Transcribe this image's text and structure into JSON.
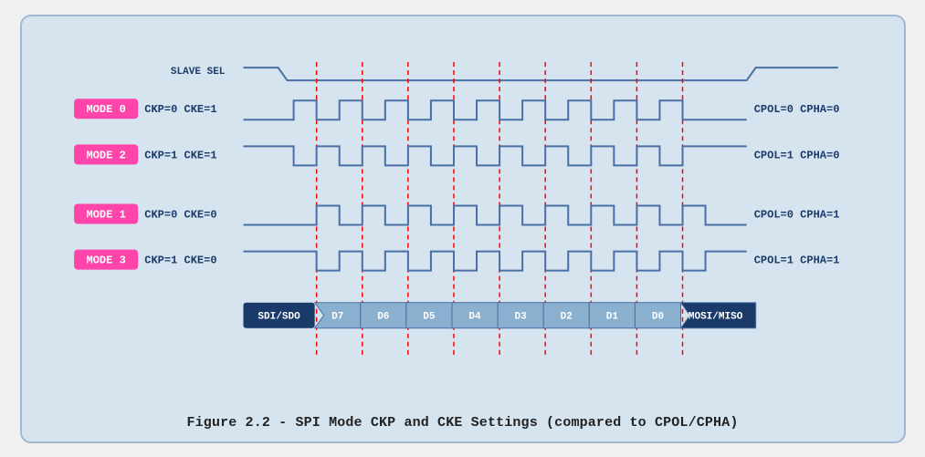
{
  "caption": "Figure 2.2 - SPI Mode CKP and CKE Settings (compared to CPOL/CPHA)",
  "modes": [
    {
      "label": "MODE 0",
      "ckp": "CKP=0",
      "cke": "CKE=1",
      "cpol": "CPOL=0",
      "cpha": "CPHA=0"
    },
    {
      "label": "MODE 2",
      "ckp": "CKP=1",
      "cke": "CKE=1",
      "cpol": "CPOL=1",
      "cpha": "CPHA=0"
    },
    {
      "label": "MODE 1",
      "ckp": "CKP=0",
      "cke": "CKE=0",
      "cpol": "CPOL=0",
      "cpha": "CPHA=1"
    },
    {
      "label": "MODE 3",
      "ckp": "CKP=1",
      "cke": "CKE=0",
      "cpol": "CPOL=1",
      "cpha": "CPHA=1"
    }
  ],
  "data_bits": [
    "D7",
    "D6",
    "D5",
    "D4",
    "D3",
    "D2",
    "D1",
    "D0"
  ],
  "slave_sel_label": "SLAVE SEL",
  "sdi_sdo_label": "SDI/SDO",
  "mosi_miso_label": "MOSI/MISO"
}
